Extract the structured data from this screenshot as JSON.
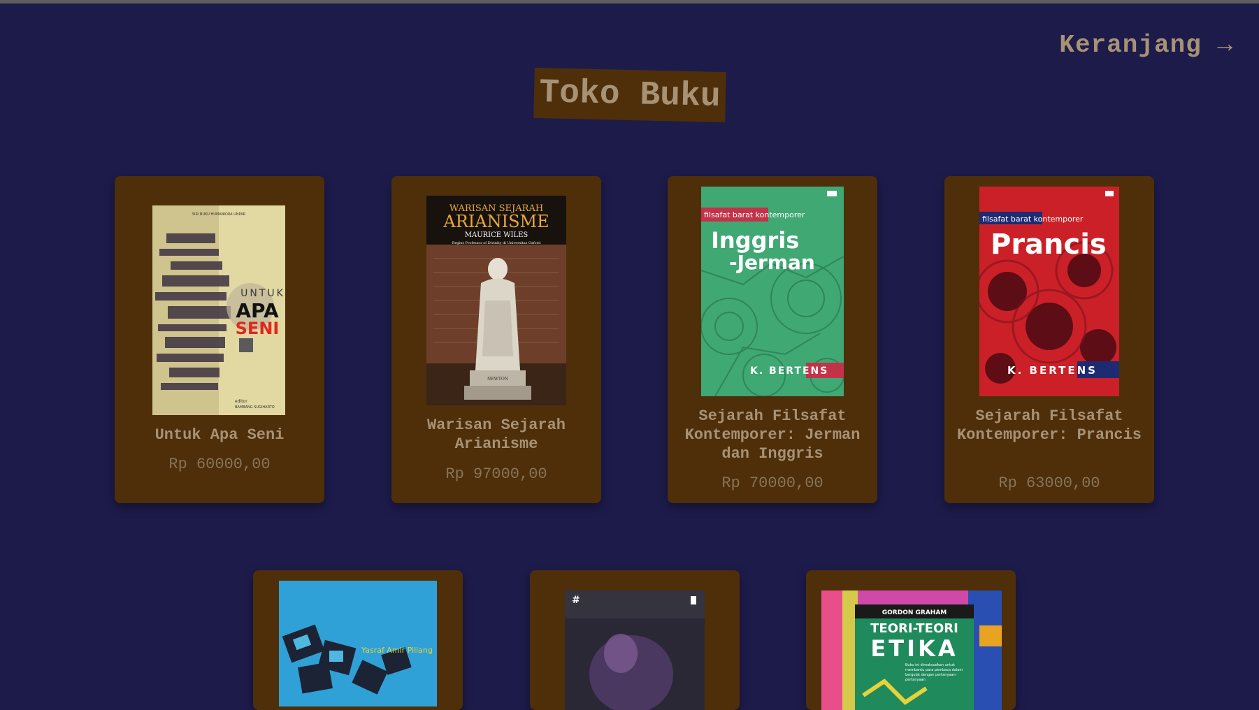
{
  "header": {
    "cart_label": "Keranjang →",
    "store_title": "Toko Buku"
  },
  "books": [
    {
      "title": "Untuk Apa Seni",
      "price": "Rp 60000,00",
      "cover": {
        "series": "SIRI BUKU HUMANIORA UNPAR",
        "top": "UNTUK",
        "line1": "APA",
        "line2": "SENI",
        "editor": "editor",
        "editor_name": "BAMBANG SUGIHARTO"
      }
    },
    {
      "title": "Warisan Sejarah Arianisme",
      "price": "Rp 97000,00",
      "cover": {
        "line1": "WARISAN SEJARAH",
        "line2": "ARIANISME",
        "author": "MAURICE WILES",
        "subtitle": "Regius Professor of Divinity di Universitas Oxford",
        "plaque": "NEWTON"
      }
    },
    {
      "title": "Sejarah Filsafat Kontemporer: Jerman dan Inggris",
      "price": "Rp 70000,00",
      "cover": {
        "series": "filsafat barat kontemporer",
        "line1": "Inggris",
        "line2": "-Jerman",
        "author": "K. BERTENS"
      }
    },
    {
      "title": "Sejarah Filsafat Kontemporer: Prancis",
      "price": "Rp 63000,00",
      "cover": {
        "series": "filsafat barat kontemporer",
        "line1": "Prancis",
        "author": "K. BERTENS"
      }
    },
    {
      "title": "",
      "price": "",
      "cover": {
        "author": "Yasraf Amir Piliang"
      }
    },
    {
      "title": "",
      "price": "",
      "cover": {
        "publisher": "#"
      }
    },
    {
      "title": "",
      "price": "",
      "cover": {
        "author": "GORDON GRAHAM",
        "line1": "TEORI-TEORI",
        "line2": "ETIKA",
        "blurb": "Buku ini dimaksudkan untuk membantu para pembaca dalam bergulat dengan pertanyaan-pertanyaan"
      }
    }
  ]
}
